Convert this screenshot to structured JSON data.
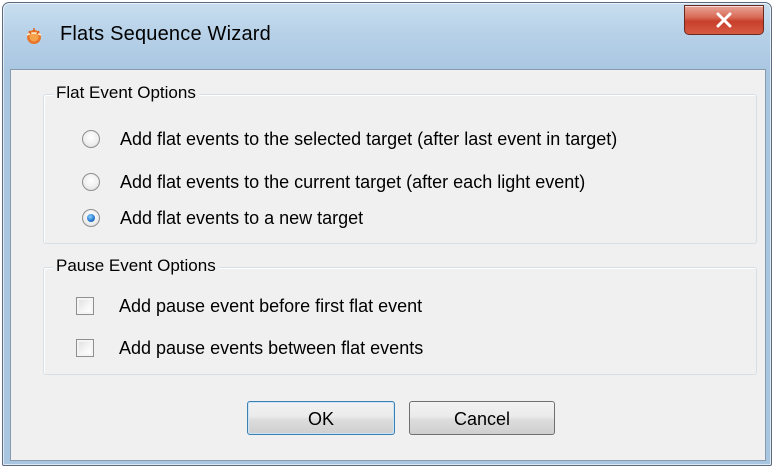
{
  "window": {
    "title": "Flats Sequence Wizard",
    "app_icon": "flame-sun-icon",
    "close_icon": "close-x-icon"
  },
  "flat_event_options": {
    "legend": "Flat Event Options",
    "options": [
      {
        "label": "Add flat events to the selected target (after last event in target)",
        "selected": false
      },
      {
        "label": "Add flat events to the current target (after each light event)",
        "selected": false
      },
      {
        "label": "Add flat events to a new target",
        "selected": true
      }
    ]
  },
  "pause_event_options": {
    "legend": "Pause Event Options",
    "options": [
      {
        "label": "Add pause event before first flat event",
        "checked": false
      },
      {
        "label": "Add pause events between flat events",
        "checked": false
      }
    ]
  },
  "buttons": {
    "ok": "OK",
    "cancel": "Cancel"
  },
  "colors": {
    "title_bar": "#b7d1e8",
    "close_button": "#c7402b",
    "radio_selected": "#2a7bd3"
  }
}
